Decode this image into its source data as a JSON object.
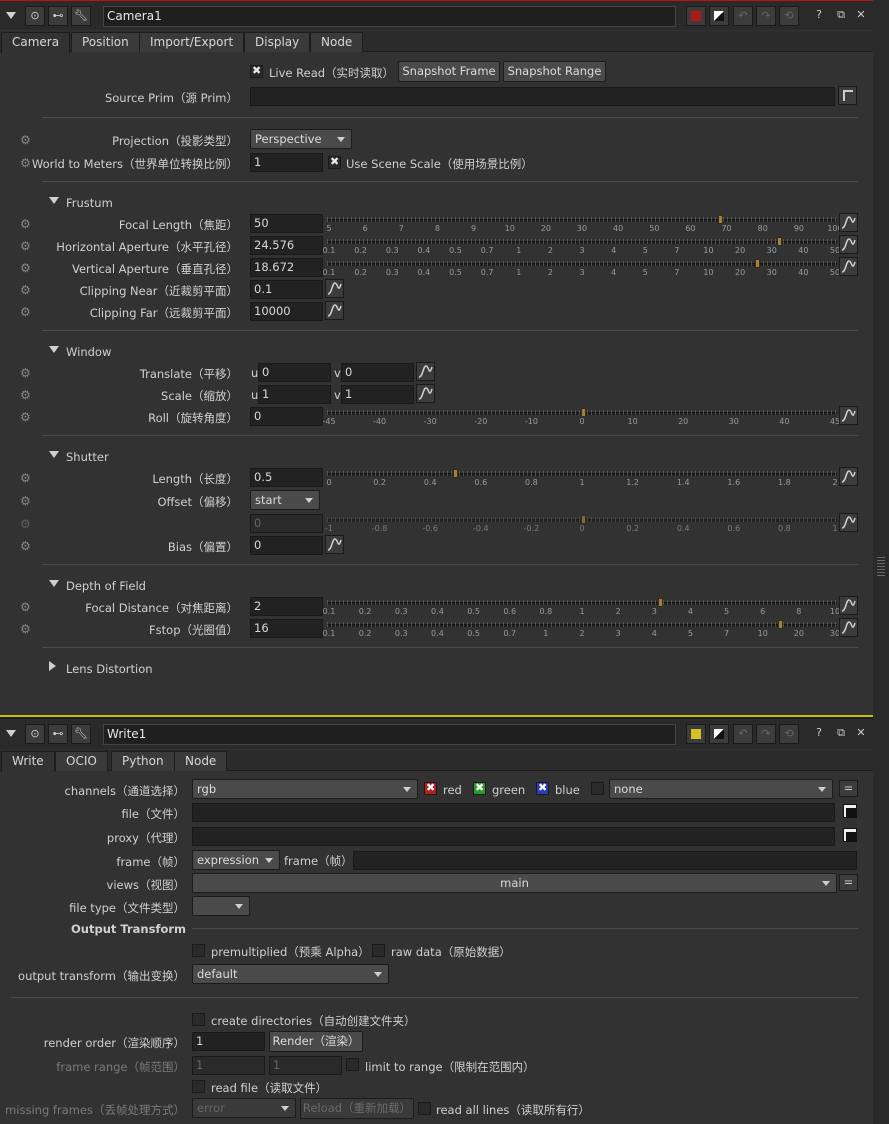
{
  "camera": {
    "name": "Camera1",
    "tabs": [
      "Camera",
      "Position",
      "Import/Export",
      "Display",
      "Node"
    ],
    "live_read": "Live Read（实时读取）",
    "snapshot_frame": "Snapshot Frame",
    "snapshot_range": "Snapshot Range",
    "source_prim_label": "Source Prim（源 Prim）",
    "source_prim_value": "",
    "projection_label": "Projection（投影类型）",
    "projection_value": "Perspective",
    "world_to_meters_label": "World to Meters（世界单位转换比例）",
    "world_to_meters_value": "1",
    "use_scene_scale": "Use Scene Scale（使用场景比例）",
    "frustum": {
      "title": "Frustum",
      "focal_length_label": "Focal Length（焦距）",
      "focal_length_value": "50",
      "focal_ticks": [
        "5",
        "6",
        "7",
        "8",
        "9",
        "10",
        "20",
        "30",
        "40",
        "50",
        "60",
        "70",
        "80",
        "90",
        "100"
      ],
      "h_aperture_label": "Horizontal Aperture（水平孔径）",
      "h_aperture_value": "24.576",
      "v_aperture_label": "Vertical Aperture（垂直孔径）",
      "v_aperture_value": "18.672",
      "aperture_ticks": [
        "0.1",
        "0.2",
        "0.3",
        "0.4",
        "0.5",
        "0.7",
        "1",
        "2",
        "3",
        "4",
        "5",
        "7",
        "10",
        "20",
        "30",
        "40",
        "50"
      ],
      "clip_near_label": "Clipping Near（近裁剪平面）",
      "clip_near_value": "0.1",
      "clip_far_label": "Clipping Far（远裁剪平面）",
      "clip_far_value": "10000"
    },
    "window": {
      "title": "Window",
      "translate_label": "Translate（平移）",
      "translate_u": "0",
      "translate_v": "0",
      "scale_label": "Scale（缩放）",
      "scale_u": "1",
      "scale_v": "1",
      "u": "u",
      "v": "v",
      "roll_label": "Roll（旋转角度）",
      "roll_value": "0",
      "roll_ticks": [
        "-45",
        "-40",
        "-30",
        "-20",
        "-10",
        "0",
        "10",
        "20",
        "30",
        "40",
        "45"
      ]
    },
    "shutter": {
      "title": "Shutter",
      "length_label": "Length（长度）",
      "length_value": "0.5",
      "length_ticks": [
        "0",
        "0.2",
        "0.4",
        "0.6",
        "0.8",
        "1",
        "1.2",
        "1.4",
        "1.6",
        "1.8",
        "2"
      ],
      "offset_label": "Offset（偏移）",
      "offset_value": "start",
      "custom_value": "0",
      "custom_ticks": [
        "-1",
        "-0.8",
        "-0.6",
        "-0.4",
        "-0.2",
        "0",
        "0.2",
        "0.4",
        "0.6",
        "0.8",
        "1"
      ],
      "bias_label": "Bias（偏置）",
      "bias_value": "0"
    },
    "dof": {
      "title": "Depth of Field",
      "focal_distance_label": "Focal Distance（对焦距离）",
      "focal_distance_value": "2",
      "focal_distance_ticks": [
        "0.1",
        "0.2",
        "0.3",
        "0.4",
        "0.5",
        "0.6",
        "0.8",
        "1",
        "2",
        "3",
        "4",
        "5",
        "6",
        "8",
        "10"
      ],
      "fstop_label": "Fstop（光圈值）",
      "fstop_value": "16",
      "fstop_ticks": [
        "0.1",
        "0.2",
        "0.3",
        "0.4",
        "0.5",
        "0.7",
        "1",
        "2",
        "3",
        "4",
        "5",
        "7",
        "10",
        "20",
        "30"
      ]
    },
    "lens_distortion": "Lens Distortion"
  },
  "write": {
    "name": "Write1",
    "tabs": [
      "Write",
      "OCIO",
      "Python",
      "Node"
    ],
    "channels_label": "channels（通道选择）",
    "channels_value": "rgb",
    "red": "red",
    "green": "green",
    "blue": "blue",
    "none": "none",
    "file_label": "file（文件）",
    "file_value": "",
    "proxy_label": "proxy（代理）",
    "proxy_value": "",
    "frame_label": "frame（帧）",
    "frame_mode": "expression",
    "frame_label2": "frame（帧）",
    "frame_value": "",
    "views_label": "views（视图）",
    "views_value": "main",
    "file_type_label": "file type（文件类型）",
    "file_type_value": "",
    "output_transform_title": "Output Transform",
    "premultiplied": "premultiplied（预乘 Alpha）",
    "raw_data": "raw data（原始数据）",
    "output_transform_label": "output transform（输出变换）",
    "output_transform_value": "default",
    "create_directories": "create directories（自动创建文件夹）",
    "render_order_label": "render order（渲染顺序）",
    "render_order_value": "1",
    "render_button": "Render（渲染）",
    "frame_range_label": "frame range（帧范围）",
    "frame_range_start": "1",
    "frame_range_end": "1",
    "limit_to_range": "limit to range（限制在范围内）",
    "read_file": "read file（读取文件）",
    "missing_frames_label": "missing frames（丢帧处理方式）",
    "missing_frames_value": "error",
    "reload_button": "Reload（重新加载）",
    "read_all_lines": "read all lines（读取所有行）"
  },
  "colors": {
    "camera_swatch": "#b01818",
    "write_swatch": "#d8c020",
    "separator": "#c8c000"
  }
}
